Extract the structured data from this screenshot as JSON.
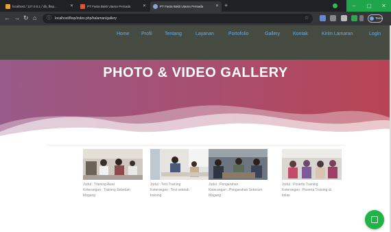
{
  "browser": {
    "tabs": [
      {
        "title": "localhost / 127.0.0.1 / db_fksp...",
        "favicon_color": "#e8a33b"
      },
      {
        "title": "PT Fasta Bakti Utama Persada",
        "favicon_color": "#e5542b"
      },
      {
        "title": "PT Fasta Bakti Utama Persada",
        "favicon_color": "#8e9fd9"
      }
    ],
    "url": "localhost/fksp/index.php/halaman/gallery",
    "profile_label": "Tamu"
  },
  "nav": {
    "items": [
      "Home",
      "Profil",
      "Tentang",
      "Layanan",
      "Portofolio",
      "Gallery",
      "Kontak",
      "Kirim Lamaran",
      "Login"
    ]
  },
  "hero": {
    "title": "PHOTO & VIDEO GALLERY"
  },
  "gallery": [
    {
      "line1": "Judul : Training Awal",
      "line2": "Keterangan : Training Sebelum",
      "line3": "Magang"
    },
    {
      "line1": "Judul : Test Training",
      "line2": "Keterangan : Test setelah",
      "line3": "training"
    },
    {
      "line1": "Judul : Pengarahan",
      "line2": "Keterangan : Pengarahan Sebelum",
      "line3": "Magang"
    },
    {
      "line1": "Judul : Peserta Training",
      "line2": "Keterangan : Peserta Training di",
      "line3": "kelas"
    }
  ],
  "colors": {
    "navbar_bg": "#464b41",
    "nav_link": "#69aee6",
    "hero_left": "#985a88",
    "hero_right": "#b84453",
    "fab": "#20b346"
  },
  "icons": {
    "fab": "chat-icon",
    "back": "back-arrow-icon",
    "forward": "forward-arrow-icon",
    "reload": "reload-icon",
    "home": "home-icon"
  }
}
